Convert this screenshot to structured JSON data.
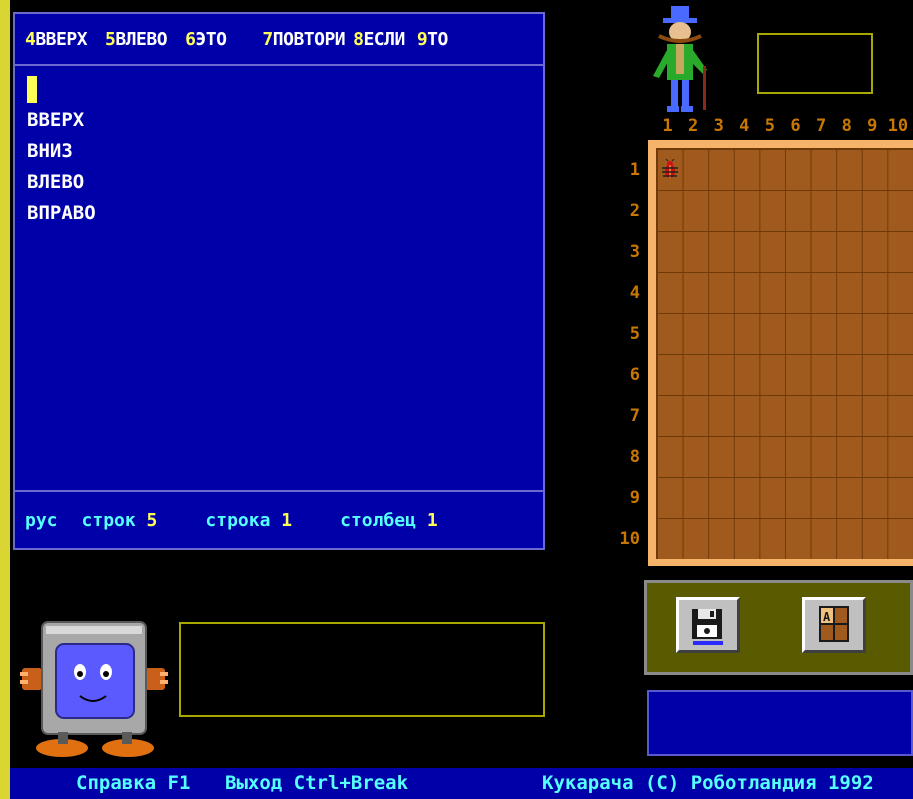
{
  "menu": [
    {
      "key": "4",
      "label": "ВВЕРХ"
    },
    {
      "key": "5",
      "label": "ВЛЕВО"
    },
    {
      "key": "6",
      "label": "ЭТО"
    },
    {
      "key": "7",
      "label": "ПОВТОРИ"
    },
    {
      "key": "8",
      "label": "ЕСЛИ"
    },
    {
      "key": "9",
      "label": "ТО"
    }
  ],
  "editor": {
    "lines": [
      "ВВЕРХ",
      "ВНИЗ",
      "ВЛЕВО",
      "ВПРАВО"
    ]
  },
  "status": {
    "lang": "рус",
    "lines_label": "строк",
    "lines_value": "5",
    "line_label": "строка",
    "line_value": "1",
    "col_label": "столбец",
    "col_value": "1"
  },
  "field": {
    "columns": [
      "1",
      "2",
      "3",
      "4",
      "5",
      "6",
      "7",
      "8",
      "9",
      "10"
    ],
    "rows": [
      "1",
      "2",
      "3",
      "4",
      "5",
      "6",
      "7",
      "8",
      "9",
      "10"
    ],
    "robot_position": {
      "row": 1,
      "col": 1
    }
  },
  "buttons": {
    "disk_icon": "floppy-disk-icon",
    "grid_icon": "field-grid-icon"
  },
  "bottom": {
    "help": "Справка F1",
    "exit": "Выход Ctrl+Break",
    "copyright": "Кукарача (С) Роботландия 1992"
  },
  "colors": {
    "background": "#000000",
    "panel_blue": "#0000a8",
    "key_yellow": "#ffff55",
    "status_cyan": "#55ffff",
    "field_brown": "#a05a1e",
    "field_border": "#f6b36a",
    "number_orange": "#c87800"
  }
}
